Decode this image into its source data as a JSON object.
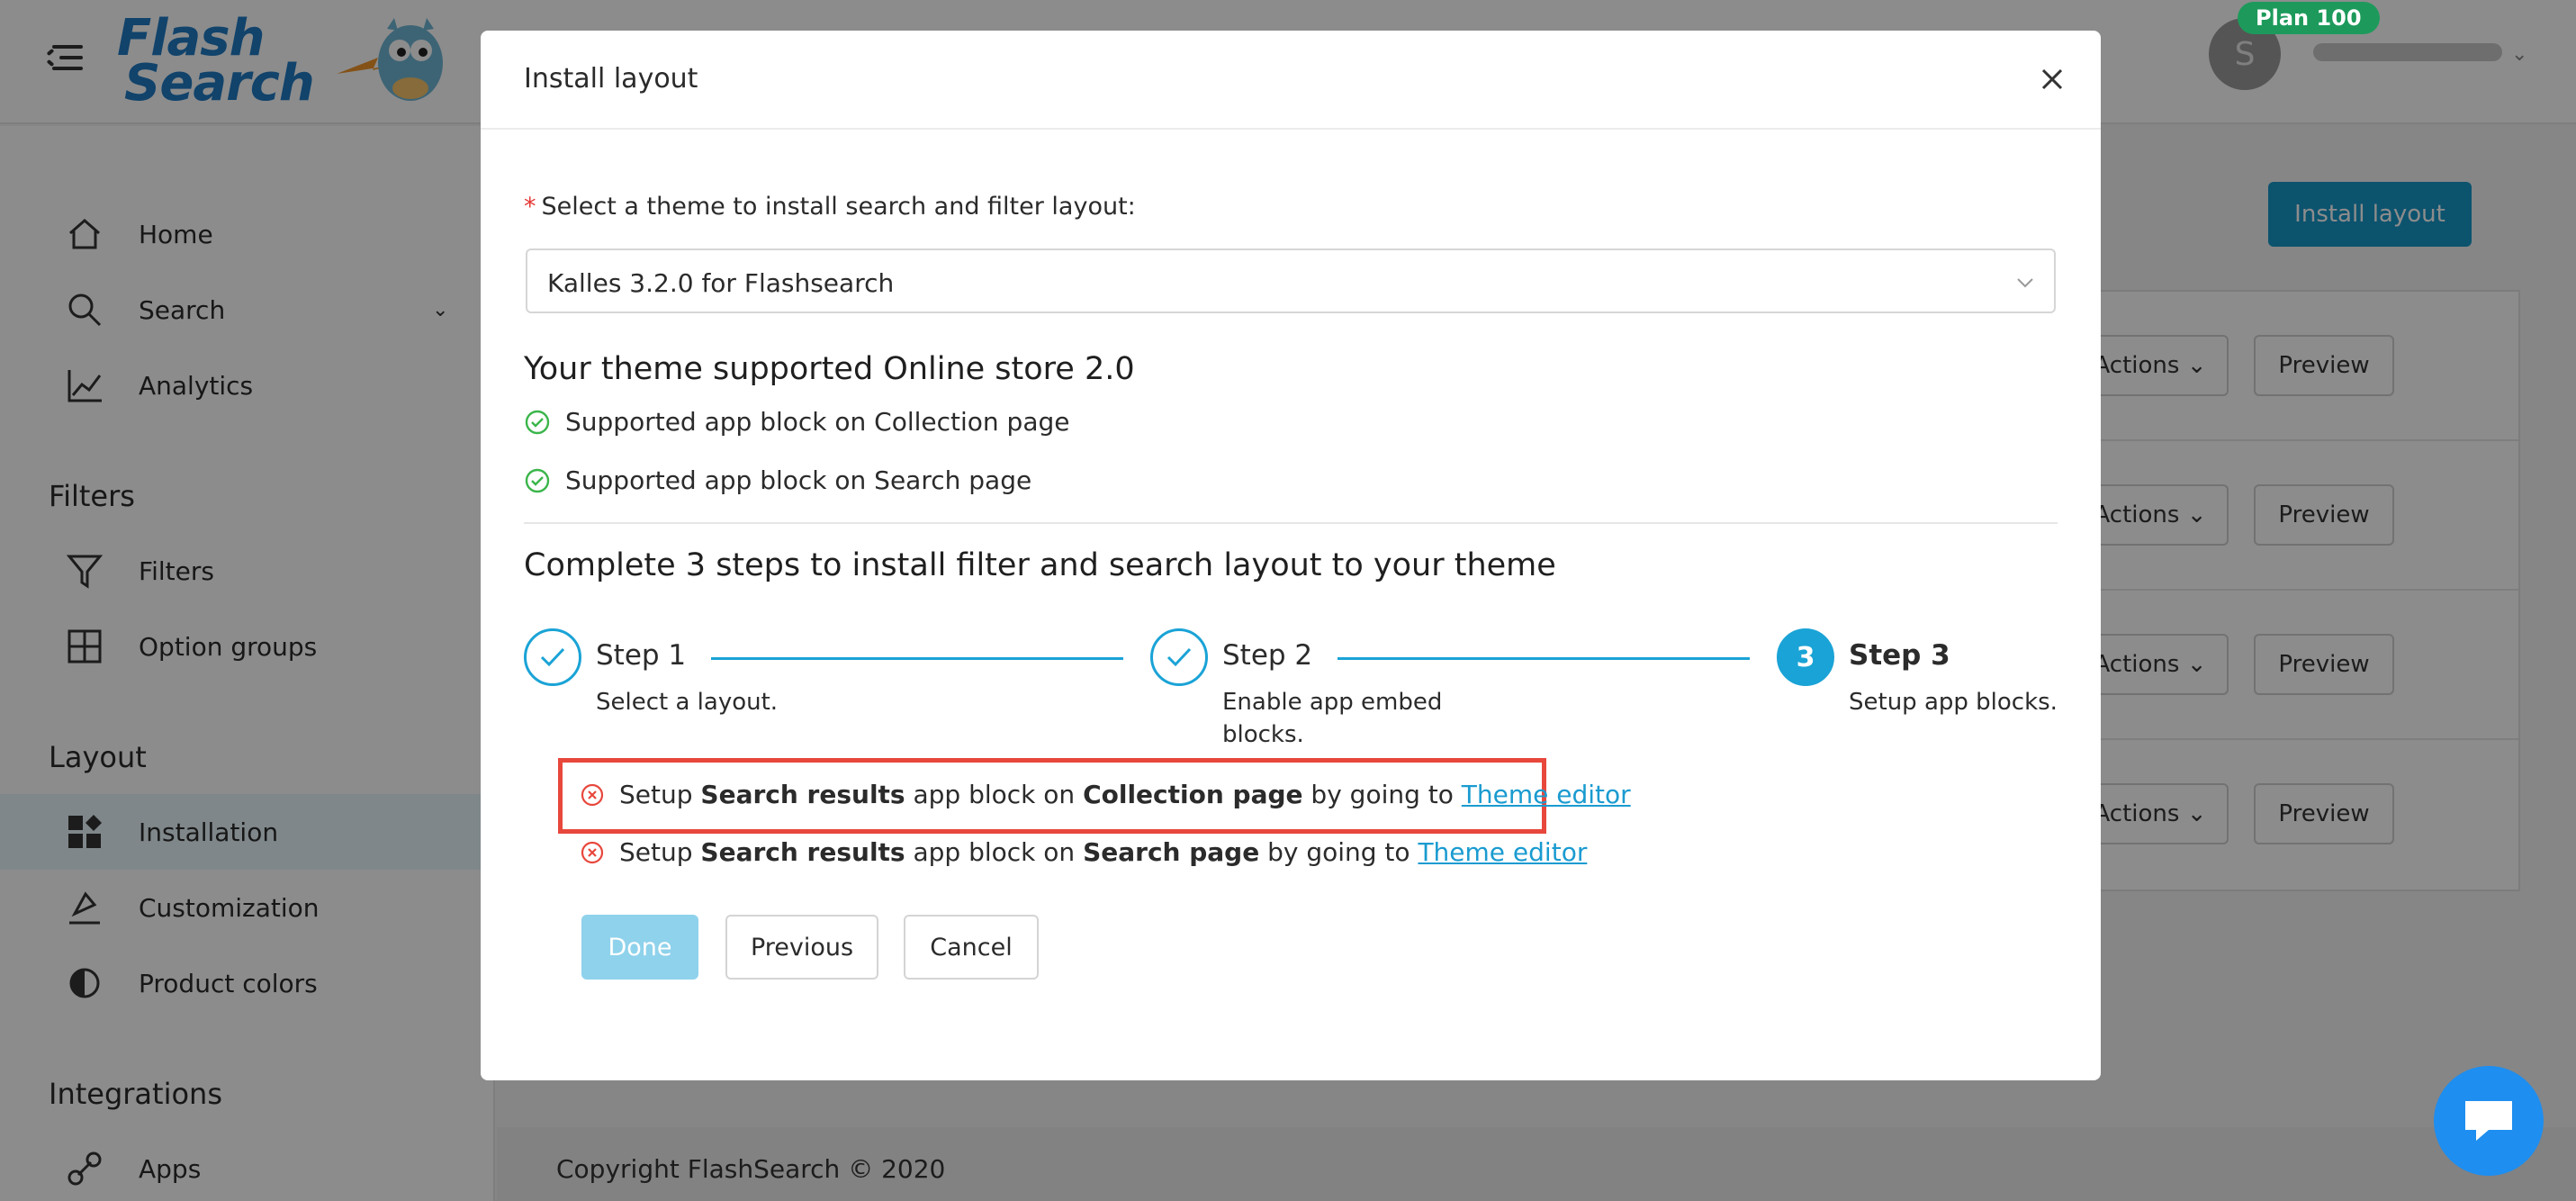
{
  "header": {
    "logo_line1": "Flash",
    "logo_line2": "Search",
    "plan_badge": "Plan 100",
    "avatar_initial": "S"
  },
  "sidebar": {
    "items": [
      {
        "label": "Home",
        "icon": "home-icon"
      },
      {
        "label": "Search",
        "icon": "search-icon"
      },
      {
        "label": "Analytics",
        "icon": "analytics-icon"
      },
      {
        "label": "Filters",
        "icon": "filter-icon"
      },
      {
        "label": "Option groups",
        "icon": "option-groups-icon"
      },
      {
        "label": "Installation",
        "icon": "installation-icon"
      },
      {
        "label": "Customization",
        "icon": "customization-icon"
      },
      {
        "label": "Product colors",
        "icon": "product-colors-icon"
      },
      {
        "label": "Apps",
        "icon": "apps-icon"
      }
    ],
    "sections": {
      "filters": "Filters",
      "layout": "Layout",
      "integrations": "Integrations"
    },
    "active_item": "Installation"
  },
  "main": {
    "install_layout_button": "Install layout",
    "rows": [
      {
        "actions": "Actions",
        "preview": "Preview"
      },
      {
        "actions": "Actions",
        "preview": "Preview"
      },
      {
        "actions": "Actions",
        "preview": "Preview"
      },
      {
        "actions": "Actions",
        "preview": "Preview"
      }
    ],
    "footer": "Copyright FlashSearch © 2020"
  },
  "modal": {
    "title": "Install layout",
    "select_label": "Select a theme to install search and filter layout:",
    "select_value": "Kalles 3.2.0 for Flashsearch",
    "support_heading": "Your theme supported Online store 2.0",
    "supported": [
      "Supported app block on Collection page",
      "Supported app block on Search page"
    ],
    "steps_heading": "Complete 3 steps to install filter and search layout to your theme",
    "steps": [
      {
        "title": "Step 1",
        "desc": "Select a layout.",
        "state": "done"
      },
      {
        "title": "Step 2",
        "desc": "Enable app embed blocks.",
        "state": "done"
      },
      {
        "number": "3",
        "title": "Step 3",
        "desc": "Setup app blocks.",
        "state": "active"
      }
    ],
    "todos": [
      {
        "prefix": "Setup ",
        "bold1": "Search results",
        "mid": " app block on ",
        "bold2": "Collection page",
        "suffix": " by going to ",
        "link": "Theme editor"
      },
      {
        "prefix": "Setup ",
        "bold1": "Search results",
        "mid": " app block on ",
        "bold2": "Search page",
        "suffix": " by going to ",
        "link": "Theme editor"
      }
    ],
    "buttons": {
      "done": "Done",
      "previous": "Previous",
      "cancel": "Cancel"
    }
  },
  "colors": {
    "accent": "#1aa3d6",
    "error": "#e8473c",
    "success": "#1d9a5b",
    "chat": "#1e8ef0"
  }
}
